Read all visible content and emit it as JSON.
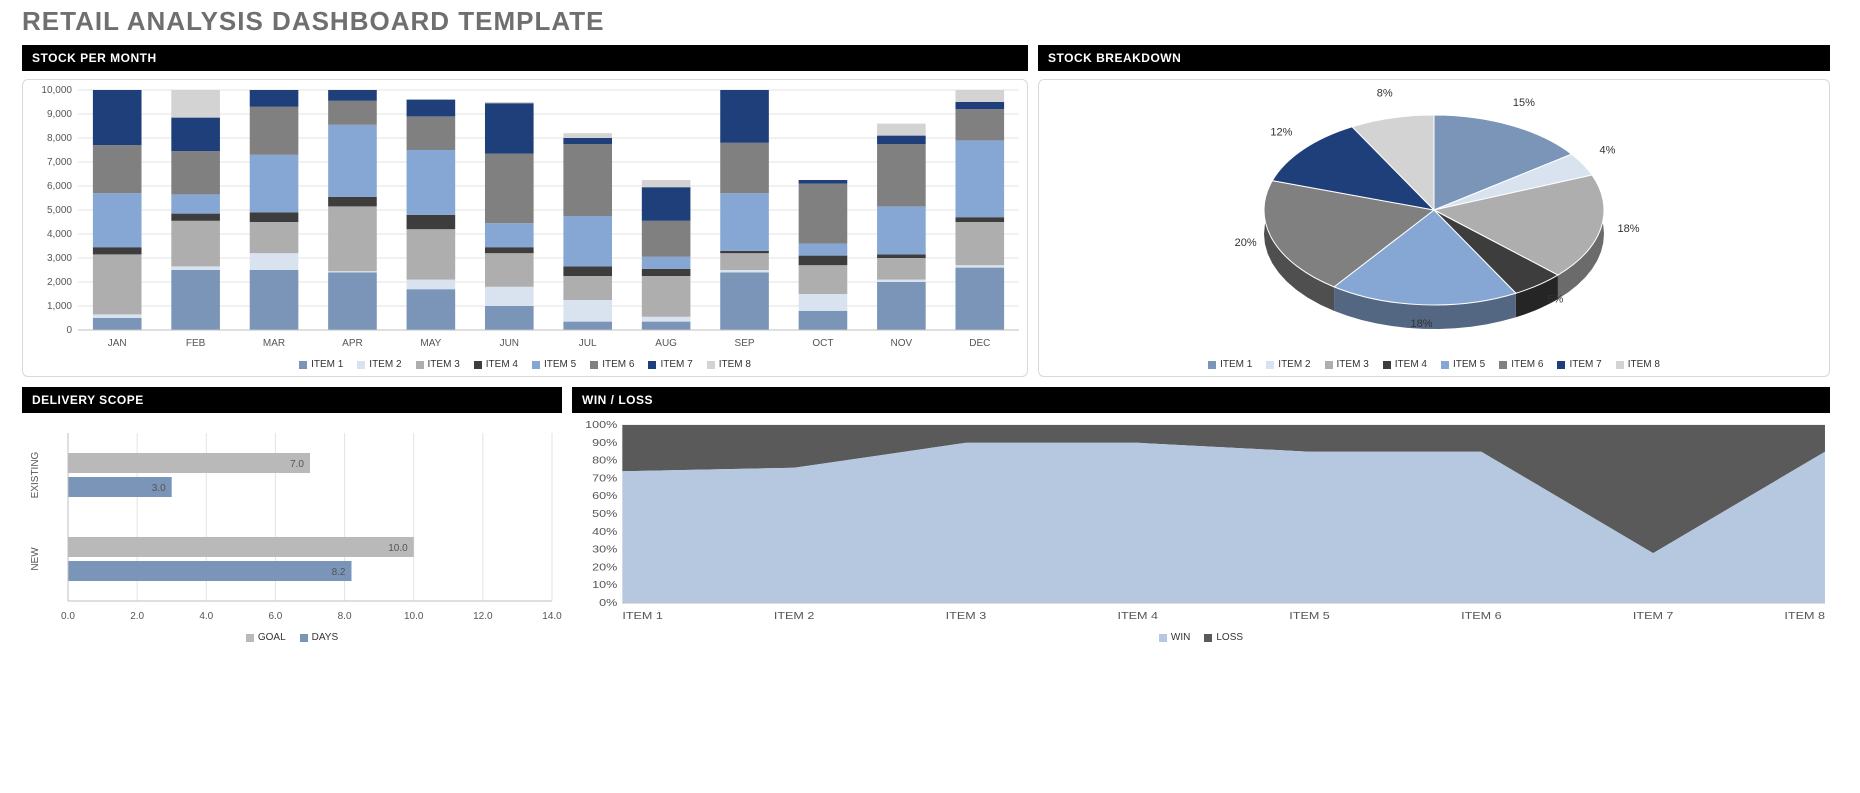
{
  "title": "RETAIL ANALYSIS DASHBOARD TEMPLATE",
  "headers": {
    "stock_per_month": "STOCK PER MONTH",
    "stock_breakdown": "STOCK BREAKDOWN",
    "delivery_scope": "DELIVERY SCOPE",
    "win_loss": "WIN / LOSS"
  },
  "palette": {
    "item1": "#7a95b8",
    "item2": "#d9e3ef",
    "item3": "#aeaeae",
    "item4": "#3d3d3d",
    "item5": "#86a7d3",
    "item6": "#808080",
    "item7": "#1f3f7a",
    "item8": "#d3d3d3",
    "goal": "#b9b9b9",
    "days": "#7a95b8",
    "win": "#b6c8df",
    "loss": "#5a5a5a"
  },
  "items": [
    "ITEM 1",
    "ITEM 2",
    "ITEM 3",
    "ITEM 4",
    "ITEM 5",
    "ITEM 6",
    "ITEM 7",
    "ITEM 8"
  ],
  "months": [
    "JAN",
    "FEB",
    "MAR",
    "APR",
    "MAY",
    "JUN",
    "JUL",
    "AUG",
    "SEP",
    "OCT",
    "NOV",
    "DEC"
  ],
  "legend_labels": {
    "goal": "GOAL",
    "days": "DAYS",
    "win": "WIN",
    "loss": "LOSS"
  },
  "chart_data": {
    "stock_per_month": {
      "type": "bar",
      "stacked": true,
      "categories": [
        "JAN",
        "FEB",
        "MAR",
        "APR",
        "MAY",
        "JUN",
        "JUL",
        "AUG",
        "SEP",
        "OCT",
        "NOV",
        "DEC"
      ],
      "ylim": [
        0,
        10000
      ],
      "yticks": [
        0,
        1000,
        2000,
        3000,
        4000,
        5000,
        6000,
        7000,
        8000,
        9000,
        10000
      ],
      "series": [
        {
          "name": "ITEM 1",
          "values": [
            500,
            2500,
            2500,
            2400,
            1700,
            1000,
            350,
            350,
            2400,
            800,
            2000,
            2600
          ]
        },
        {
          "name": "ITEM 2",
          "values": [
            150,
            150,
            700,
            50,
            400,
            800,
            900,
            200,
            100,
            700,
            100,
            100
          ]
        },
        {
          "name": "ITEM 3",
          "values": [
            2500,
            1900,
            1300,
            2700,
            2100,
            1400,
            1000,
            1700,
            700,
            1200,
            900,
            1800
          ]
        },
        {
          "name": "ITEM 4",
          "values": [
            300,
            300,
            400,
            400,
            600,
            250,
            400,
            300,
            100,
            400,
            150,
            200
          ]
        },
        {
          "name": "ITEM 5",
          "values": [
            2250,
            800,
            2400,
            3000,
            2700,
            1000,
            2100,
            500,
            2400,
            500,
            2000,
            3200
          ]
        },
        {
          "name": "ITEM 6",
          "values": [
            2000,
            1800,
            2000,
            1000,
            1400,
            2900,
            3000,
            1500,
            2100,
            2500,
            2600,
            1300
          ]
        },
        {
          "name": "ITEM 7",
          "values": [
            2300,
            1400,
            700,
            450,
            700,
            2100,
            250,
            1400,
            2200,
            150,
            350,
            300
          ]
        },
        {
          "name": "ITEM 8",
          "values": [
            0,
            1150,
            0,
            0,
            0,
            50,
            200,
            300,
            0,
            0,
            500,
            500
          ]
        }
      ]
    },
    "stock_breakdown": {
      "type": "pie",
      "labels": [
        "ITEM 1",
        "ITEM 2",
        "ITEM 3",
        "ITEM 4",
        "ITEM 5",
        "ITEM 6",
        "ITEM 7",
        "ITEM 8"
      ],
      "values_pct": [
        15,
        4,
        18,
        5,
        18,
        20,
        12,
        8
      ]
    },
    "delivery_scope": {
      "type": "bar",
      "orientation": "horizontal",
      "categories": [
        "EXISTING",
        "NEW"
      ],
      "xlim": [
        0,
        14
      ],
      "xticks": [
        0,
        2,
        4,
        6,
        8,
        10,
        12,
        14
      ],
      "series": [
        {
          "name": "GOAL",
          "values": [
            7.0,
            10.0
          ]
        },
        {
          "name": "DAYS",
          "values": [
            3.0,
            8.2
          ]
        }
      ]
    },
    "win_loss": {
      "type": "area",
      "stacked_pct": true,
      "categories": [
        "ITEM 1",
        "ITEM 2",
        "ITEM 3",
        "ITEM 4",
        "ITEM 5",
        "ITEM 6",
        "ITEM 7",
        "ITEM 8"
      ],
      "yticks_pct": [
        0,
        10,
        20,
        30,
        40,
        50,
        60,
        70,
        80,
        90,
        100
      ],
      "series": [
        {
          "name": "WIN",
          "values_pct": [
            74,
            76,
            90,
            90,
            85,
            85,
            28,
            85
          ]
        },
        {
          "name": "LOSS",
          "values_pct": [
            26,
            24,
            10,
            10,
            15,
            15,
            72,
            15
          ]
        }
      ]
    }
  }
}
